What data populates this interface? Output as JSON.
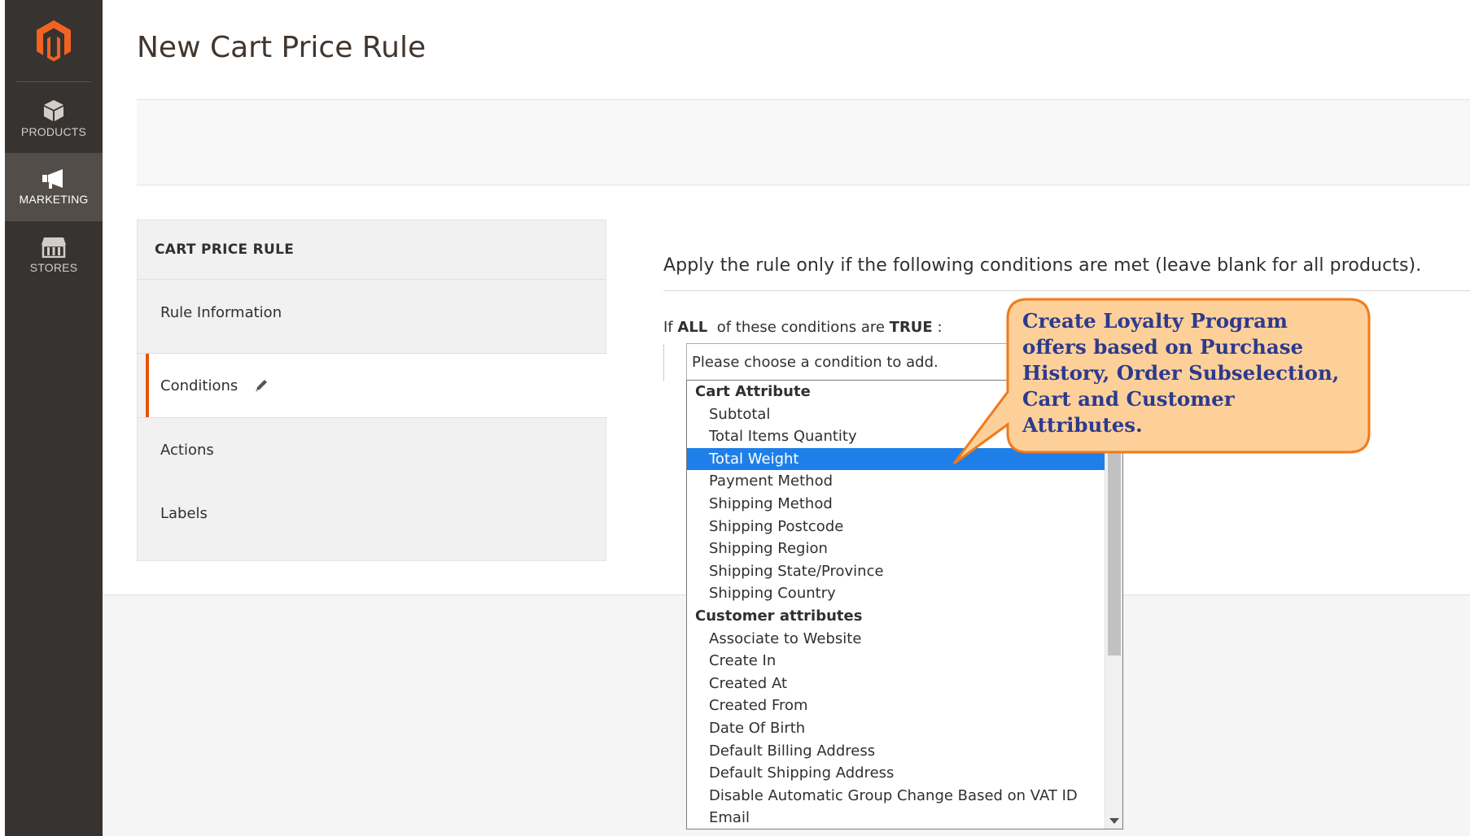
{
  "sidebar": {
    "logo_icon": "magento-logo-icon",
    "items": [
      {
        "label": "PRODUCTS",
        "icon": "cube-icon",
        "active": false
      },
      {
        "label": "MARKETING",
        "icon": "megaphone-icon",
        "active": true
      },
      {
        "label": "STORES",
        "icon": "store-icon",
        "active": false
      }
    ]
  },
  "header": {
    "title": "New Cart Price Rule"
  },
  "tabs_panel": {
    "title": "CART PRICE RULE",
    "tabs": [
      {
        "label": "Rule Information",
        "active": false
      },
      {
        "label": "Conditions",
        "active": true,
        "icon": "pencil-icon"
      },
      {
        "label": "Actions",
        "active": false
      },
      {
        "label": "Labels",
        "active": false
      }
    ]
  },
  "conditions": {
    "heading": "Apply the rule only if the following conditions are met (leave blank for all products).",
    "sentence_if": "If",
    "sentence_all": "ALL",
    "sentence_mid": "of these conditions are",
    "sentence_true": "TRUE",
    "sentence_end": ":",
    "select_placeholder": "Please choose a condition to add.",
    "groups": [
      {
        "label": "Cart Attribute",
        "options": [
          "Subtotal",
          "Total Items Quantity",
          "Total Weight",
          "Payment Method",
          "Shipping Method",
          "Shipping Postcode",
          "Shipping Region",
          "Shipping State/Province",
          "Shipping Country"
        ]
      },
      {
        "label": "Customer attributes",
        "options": [
          "Associate to Website",
          "Create In",
          "Created At",
          "Created From",
          "Date Of Birth",
          "Default Billing Address",
          "Default Shipping Address",
          "Disable Automatic Group Change Based on VAT ID",
          "Email"
        ]
      }
    ],
    "selected_option": "Total Weight"
  },
  "callout": {
    "lines": [
      "Create Loyalty Program",
      "offers based on Purchase",
      "History, Order Subselection,",
      "Cart and Customer",
      "Attributes."
    ],
    "fill_color": "#fdd09a",
    "border_color": "#f07a1a",
    "text_color": "#2d3a8c"
  },
  "colors": {
    "sidebar_bg": "#373330",
    "sidebar_active": "#524d49",
    "accent": "#eb5202",
    "selected_option_bg": "#1e7fe8"
  }
}
